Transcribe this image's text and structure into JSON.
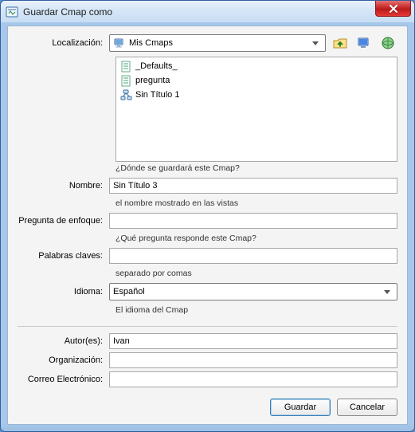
{
  "window": {
    "title": "Guardar Cmap como"
  },
  "labels": {
    "location": "Localización:",
    "name": "Nombre:",
    "focus_question": "Pregunta de enfoque:",
    "keywords": "Palabras claves:",
    "language": "Idioma:",
    "authors": "Autor(es):",
    "organization": "Organización:",
    "email": "Correo Electrónico:"
  },
  "location": {
    "selected": "Mis Cmaps"
  },
  "file_list": [
    {
      "icon": "cmap-doc",
      "label": "_Defaults_"
    },
    {
      "icon": "cmap-doc",
      "label": "pregunta"
    },
    {
      "icon": "cmap-untitled",
      "label": "Sin Título 1"
    }
  ],
  "hints": {
    "location": "¿Dónde se guardará este Cmap?",
    "name": "el nombre mostrado en las vistas",
    "focus_question": "¿Qué pregunta responde este Cmap?",
    "keywords": "separado por comas",
    "language": "El idioma del Cmap"
  },
  "fields": {
    "name": "Sin Título 3",
    "focus_question": "",
    "keywords": "",
    "language": "Español",
    "authors": "Ivan",
    "organization": "",
    "email": ""
  },
  "buttons": {
    "save": "Guardar",
    "cancel": "Cancelar"
  }
}
